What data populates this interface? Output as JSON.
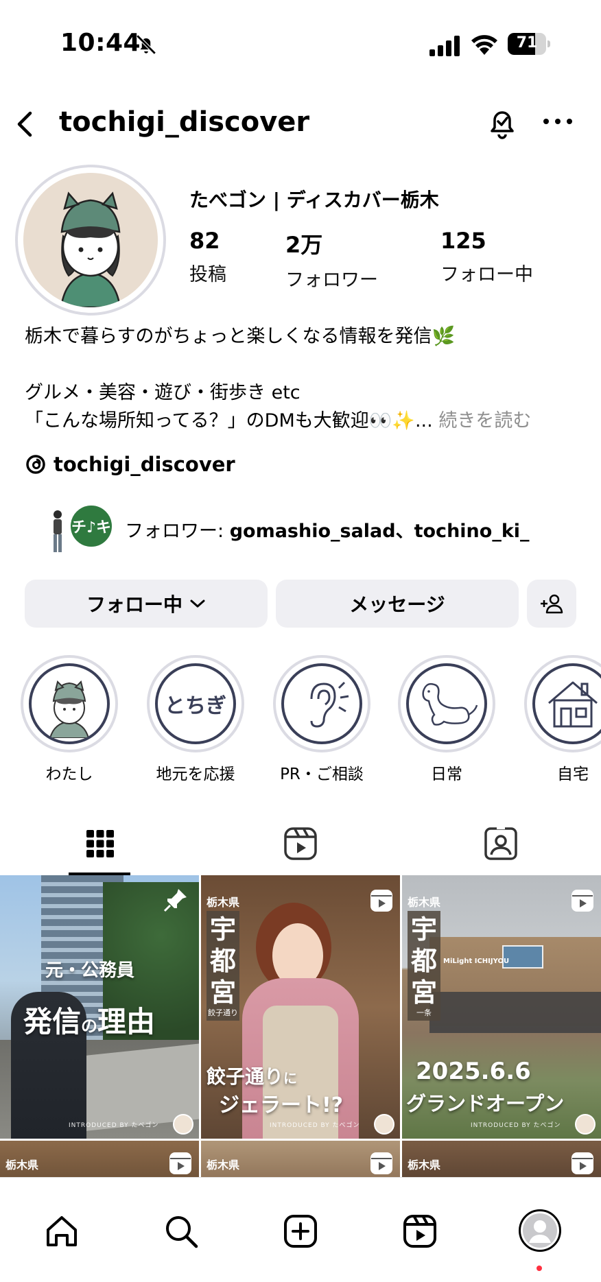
{
  "status_bar": {
    "time": "10:44",
    "battery": "71",
    "battery_level": 0.71
  },
  "header": {
    "username": "tochigi_discover"
  },
  "profile": {
    "display_name": "たべゴン | ディスカバー栃木",
    "stats": [
      {
        "value": "82",
        "label": "投稿"
      },
      {
        "value": "2万",
        "label": "フォロワー"
      },
      {
        "value": "125",
        "label": "フォロー中"
      }
    ],
    "bio": {
      "line1": "栃木で暮らすのがちょっと楽しくなる情報を発信🌿",
      "line2": "グルメ・美容・遊び・街歩き etc",
      "line3": "「こんな場所知ってる？」のDMも大歓迎👀✨...",
      "more": "続きを読む"
    },
    "threads_handle": "tochigi_discover",
    "followed_by": {
      "prefix": "フォロワー: ",
      "names": "gomashio_salad、tochino_ki_",
      "badge_text": "チ♪キ"
    }
  },
  "buttons": {
    "following": "フォロー中",
    "message": "メッセージ"
  },
  "highlights": [
    {
      "label": "わたし",
      "icon": "avatar-icon"
    },
    {
      "label": "地元を応援",
      "icon": "tochigi-text-icon",
      "text": "とちぎ"
    },
    {
      "label": "PR・ご相談",
      "icon": "ear-icon"
    },
    {
      "label": "日常",
      "icon": "dog-icon"
    },
    {
      "label": "自宅",
      "icon": "house-icon"
    }
  ],
  "tabs": [
    "grid-icon",
    "reels-icon",
    "tagged-icon"
  ],
  "posts": [
    {
      "caption_small": "元・公務員",
      "caption_big_1": "発信",
      "caption_mid": "の",
      "caption_big_2": "理由",
      "intro": "INTRODUCED BY たべゴン"
    },
    {
      "pref": "栃木県",
      "city": [
        "宇",
        "都",
        "宮"
      ],
      "city_sub": "餃子通り",
      "caption_1": "餃子通り",
      "caption_1b": "に",
      "caption_2": "ジェラート!?",
      "intro": "INTRODUCED BY たべゴン"
    },
    {
      "pref": "栃木県",
      "city": [
        "宇",
        "都",
        "宮"
      ],
      "city_sub": "一条",
      "date": "2025.6.6",
      "caption": "グランドオープン",
      "sign": "MiLight ICHIJYOU",
      "intro": "INTRODUCED BY たべゴン"
    },
    {
      "pref": "栃木県"
    },
    {
      "pref": "栃木県"
    },
    {
      "pref": "栃木県"
    }
  ],
  "colors": {
    "accent_dark": "#3a3f58",
    "button_bg": "#efeff3",
    "badge_green": "#2f7a3f",
    "notif_dot": "#ff3040"
  }
}
